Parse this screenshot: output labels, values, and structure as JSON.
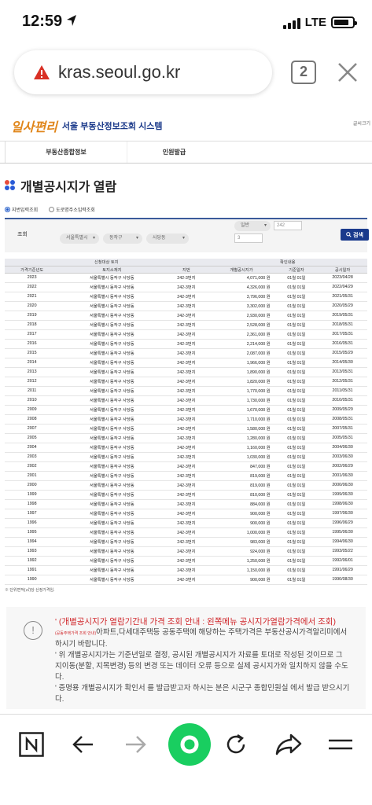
{
  "status": {
    "time": "12:59",
    "network": "LTE"
  },
  "browser": {
    "url": "kras.seoul.go.kr",
    "tab_count": "2"
  },
  "site": {
    "logo_main": "일사",
    "logo_accent": "편리",
    "title": "서울 부동산정보조회 시스템",
    "login": "글씨크기"
  },
  "nav": [
    "부동산종합정보",
    "인원발급"
  ],
  "heading": "개별공시지가 열람",
  "search": {
    "options": [
      "지번입력조회",
      "도로명주소입력조회"
    ],
    "label": "조회",
    "city": "서울특별시",
    "district": "동작구",
    "dong": "사당동",
    "type": "일반",
    "bun": "242",
    "ji": "3",
    "button": "검색"
  },
  "table": {
    "group_headers": [
      "신청대상 토지",
      "확인내용"
    ],
    "columns": [
      "가격기준년도",
      "토지소재지",
      "지번",
      "개별공시지가",
      "기준일자",
      "공시일자"
    ],
    "location": "서울특별시 동작구 사당동",
    "jibun": "242-3번지",
    "base_date": "01월 01일",
    "rows": [
      [
        "2023",
        "4,071,000 원",
        "2023/04/28"
      ],
      [
        "2022",
        "4,326,000 원",
        "2022/04/29"
      ],
      [
        "2021",
        "3,796,000 원",
        "2021/05/31"
      ],
      [
        "2020",
        "3,302,000 원",
        "2020/05/29"
      ],
      [
        "2019",
        "2,930,000 원",
        "2019/05/31"
      ],
      [
        "2018",
        "2,528,000 원",
        "2018/05/31"
      ],
      [
        "2017",
        "2,361,000 원",
        "2017/05/31"
      ],
      [
        "2016",
        "2,214,000 원",
        "2016/05/31"
      ],
      [
        "2015",
        "2,087,000 원",
        "2015/05/29"
      ],
      [
        "2014",
        "1,966,000 원",
        "2014/05/30"
      ],
      [
        "2013",
        "1,890,000 원",
        "2013/05/31"
      ],
      [
        "2012",
        "1,820,000 원",
        "2012/05/31"
      ],
      [
        "2011",
        "1,770,000 원",
        "2011/05/31"
      ],
      [
        "2010",
        "1,730,000 원",
        "2010/05/31"
      ],
      [
        "2009",
        "1,670,000 원",
        "2009/05/29"
      ],
      [
        "2008",
        "1,710,000 원",
        "2008/05/31"
      ],
      [
        "2007",
        "1,580,000 원",
        "2007/05/31"
      ],
      [
        "2005",
        "1,280,000 원",
        "2005/05/31"
      ],
      [
        "2004",
        "1,160,000 원",
        "2004/06/30"
      ],
      [
        "2003",
        "1,030,000 원",
        "2003/06/30"
      ],
      [
        "2002",
        "847,000 원",
        "2002/06/29"
      ],
      [
        "2001",
        "819,000 원",
        "2001/06/30"
      ],
      [
        "2000",
        "819,000 원",
        "2000/06/30"
      ],
      [
        "1999",
        "810,000 원",
        "1999/06/30"
      ],
      [
        "1998",
        "884,000 원",
        "1998/06/30"
      ],
      [
        "1997",
        "900,000 원",
        "1997/06/30"
      ],
      [
        "1996",
        "900,000 원",
        "1996/06/29"
      ],
      [
        "1995",
        "1,000,000 원",
        "1995/06/30"
      ],
      [
        "1994",
        "983,000 원",
        "1994/06/30"
      ],
      [
        "1993",
        "924,000 원",
        "1993/05/22"
      ],
      [
        "1992",
        "1,250,000 원",
        "1992/06/01"
      ],
      [
        "1991",
        "1,150,000 원",
        "1991/06/29"
      ],
      [
        "1990",
        "900,000 원",
        "1990/08/30"
      ]
    ],
    "unit_note": "※ 단위면적(㎡)당 산정가격임."
  },
  "notice": {
    "line1": "' (개별공시지가 열람기간내 가격 조회 안내 : 왼쪽메뉴 공시지가열람가격에서 조회)",
    "line2_small": "(공동주택가격 조회 안내)",
    "line2": "아파트,다세대주택등 공동주택에 해당하는 주택가격은 부동산공시가격알리미에서",
    "line3": "하시기 바랍니다.",
    "line4": "' 위 개별공시지가는 기준년일로 결정, 공시된 개별공시지가 자료를 토대로 작성된 것이므로 그",
    "line5": "지이동(분할, 지목변경) 등의 변경 또는 데이터 오류 등으로 실제 공시지가와 일치하지 않을 수도",
    "line6": "다.",
    "line7": "' 증명용 개별공시지가 확인서 를 발급받고자 하시는 분은 시군구 종합민원실 에서 발급 받으시기",
    "line8": "다."
  },
  "colors": {
    "accent": "#1a3a8c",
    "notice_red": "#d0262a",
    "naver_green": "#19ce60"
  }
}
